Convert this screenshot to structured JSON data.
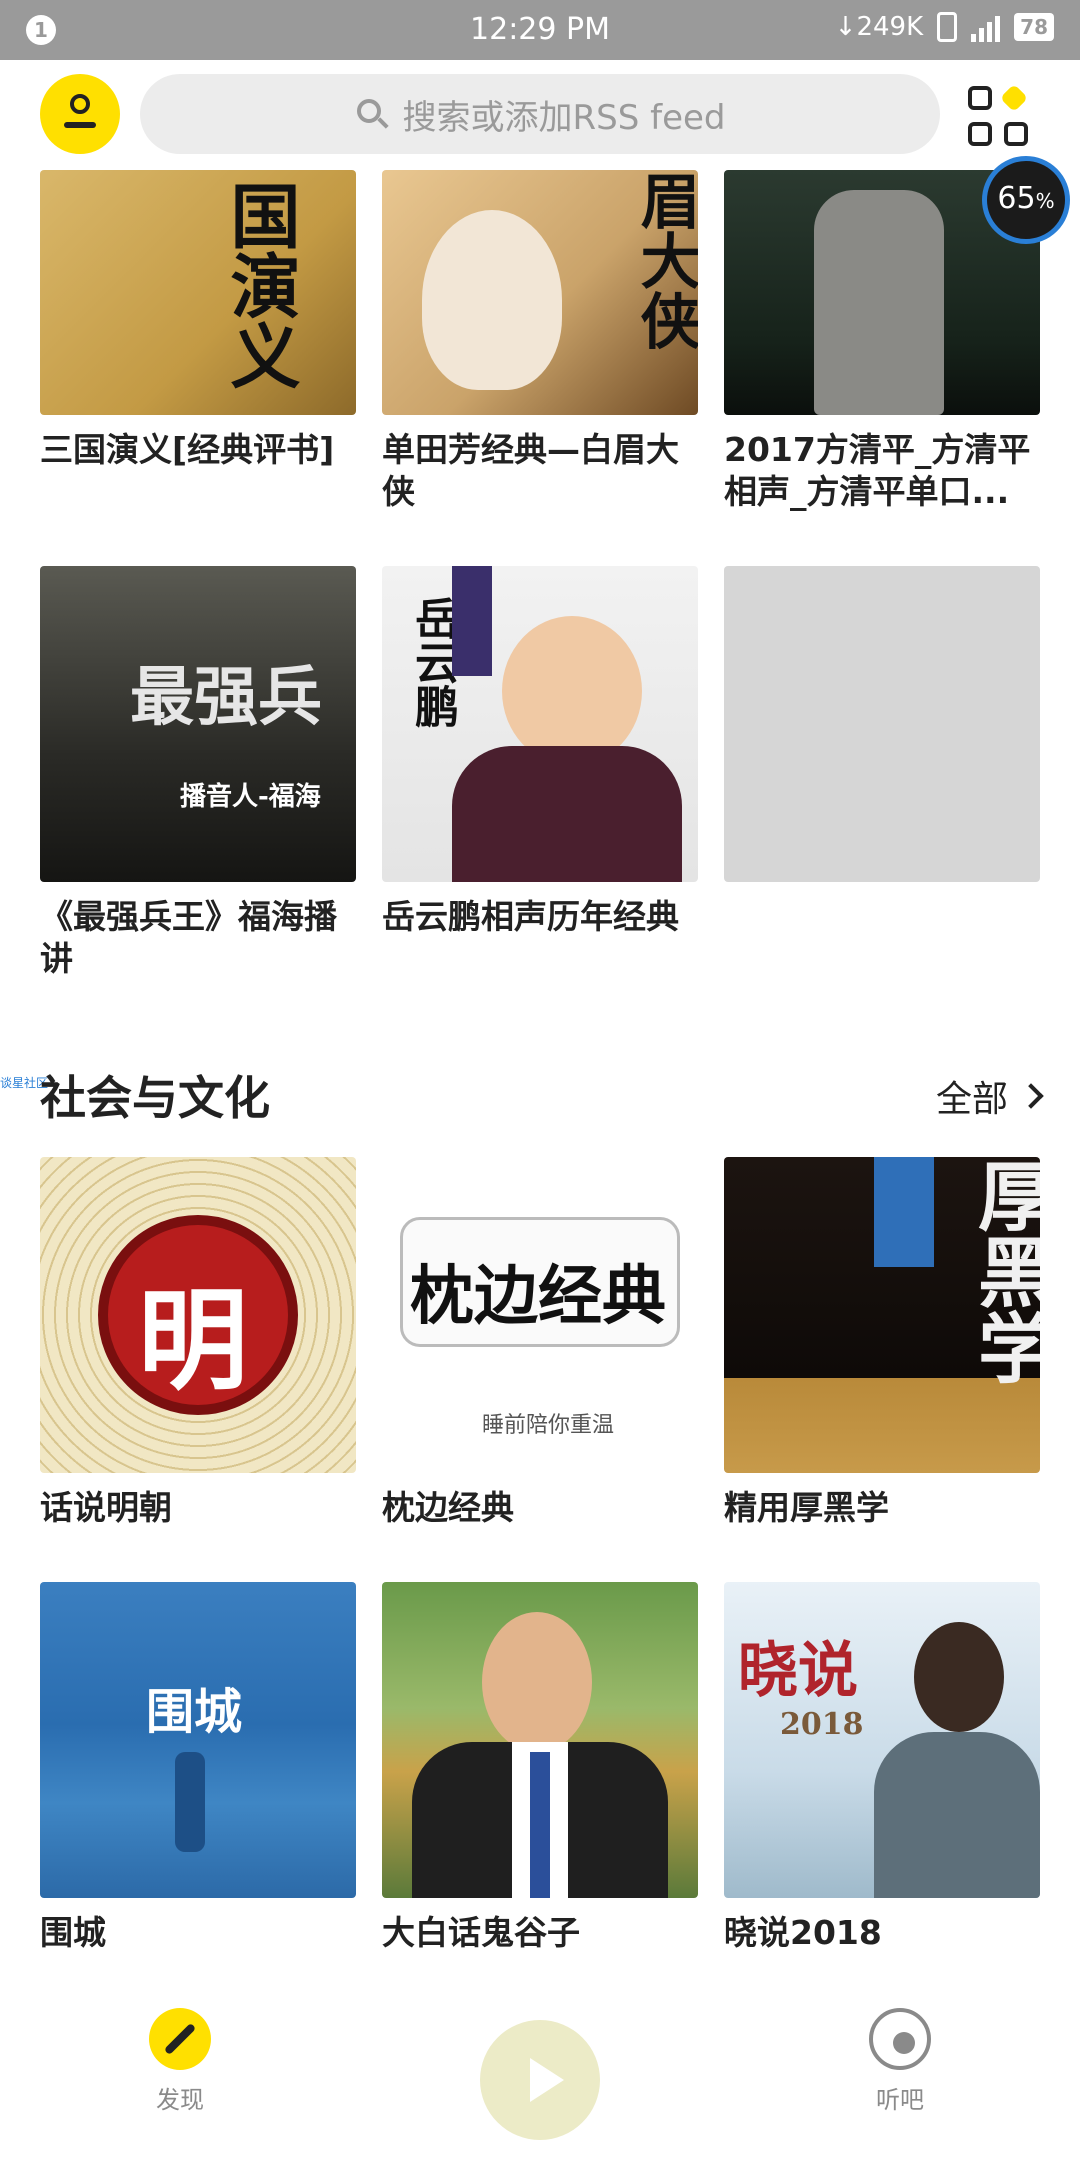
{
  "status_bar": {
    "notification_count": "1",
    "time": "12:29 PM",
    "net_speed": "249K",
    "battery": "78"
  },
  "header": {
    "search_placeholder": "搜索或添加RSS feed"
  },
  "progress_badge": {
    "value": "65",
    "unit": "%"
  },
  "top_rows": [
    {
      "title": "三国演义[经典评书]",
      "cover_text": "国演义"
    },
    {
      "title": "单田芳经典—白眉大侠",
      "cover_text": "眉大侠"
    },
    {
      "title": "2017方清平_方清平相声_方清平单口...",
      "cover_text": ""
    },
    {
      "title": "《最强兵王》福海播讲",
      "cover_text": "最强兵",
      "cover_sub": "播音人-福海"
    },
    {
      "title": "岳云鹏相声历年经典",
      "cover_text": "岳云鹏"
    },
    {
      "title": "",
      "cover_text": ""
    }
  ],
  "section": {
    "side_text": "谈星社区",
    "title": "社会与文化",
    "more_label": "全部"
  },
  "section_items": [
    {
      "title": "话说明朝",
      "cover_text": "明"
    },
    {
      "title": "枕边经典",
      "cover_text": "枕边经典",
      "cover_sub": "睡前陪你重温"
    },
    {
      "title": "精用厚黑学",
      "cover_text": "厚黑学"
    },
    {
      "title": "围城",
      "cover_text": "围城"
    },
    {
      "title": "大白话鬼谷子",
      "cover_text": ""
    },
    {
      "title": "晓说2018",
      "cover_text": "晓说",
      "cover_sub": "2018"
    }
  ],
  "bottom_nav": {
    "discover_label": "发现",
    "listen_label": "听吧"
  },
  "colors": {
    "accent": "#ffe000",
    "statusbar": "#9a9a9a"
  }
}
